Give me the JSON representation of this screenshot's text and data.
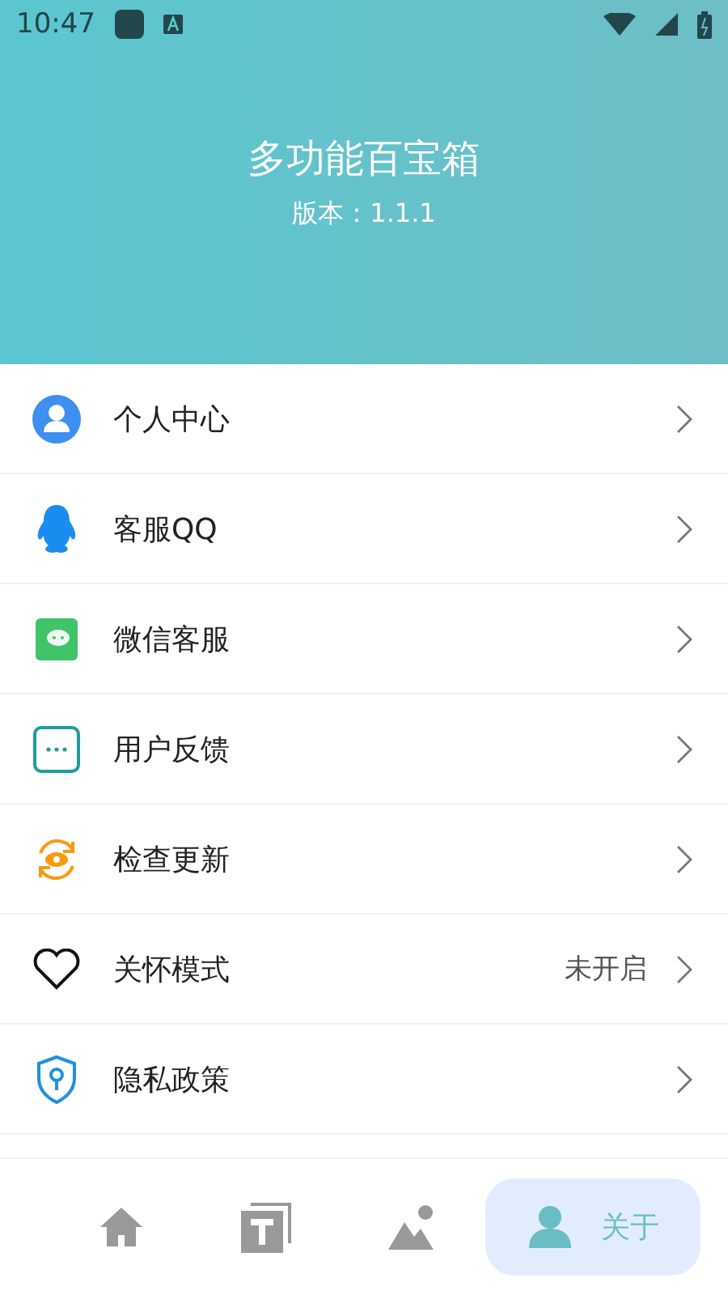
{
  "status_bar": {
    "time": "10:47"
  },
  "header": {
    "title": "多功能百宝箱",
    "version": "版本：1.1.1"
  },
  "menu": [
    {
      "title": "个人中心"
    },
    {
      "title": "客服QQ"
    },
    {
      "title": "微信客服"
    },
    {
      "title": "用户反馈"
    },
    {
      "title": "检查更新"
    },
    {
      "title": "关怀模式",
      "value": "未开启"
    },
    {
      "title": "隐私政策"
    }
  ],
  "tabs": [
    {
      "selected": false
    },
    {
      "selected": false
    },
    {
      "selected": false
    },
    {
      "selected": true,
      "label": "关于"
    }
  ]
}
